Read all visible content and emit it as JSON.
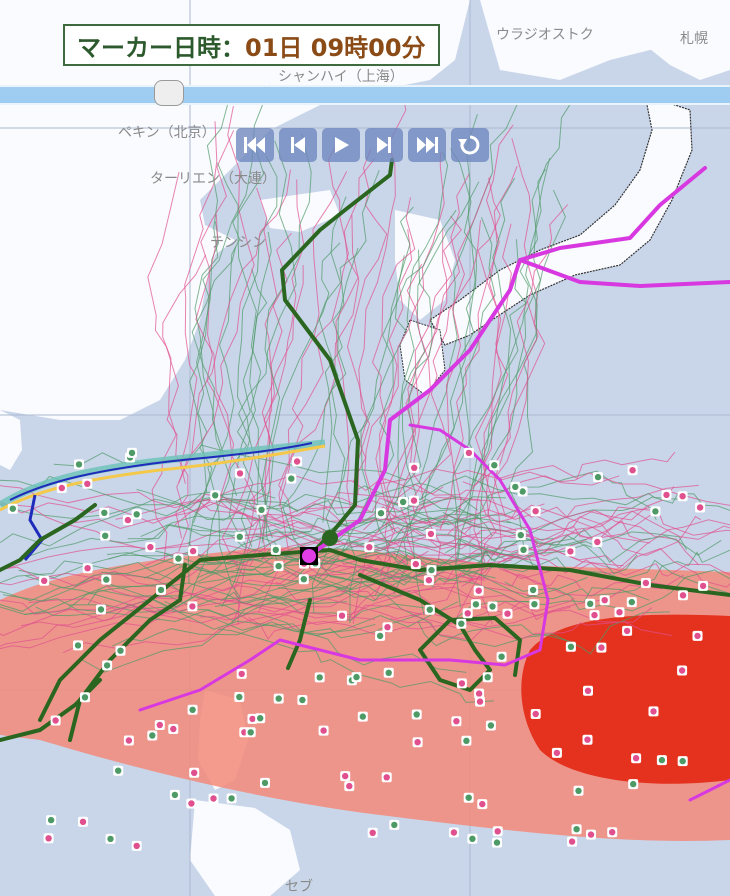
{
  "marker_time": {
    "label": "マーカー日時：",
    "value": "01日 09時00分"
  },
  "slider": {
    "level": 0.22
  },
  "controls": [
    {
      "name": "skip-to-start-button",
      "icon": "skip-start-icon"
    },
    {
      "name": "step-back-button",
      "icon": "step-back-icon"
    },
    {
      "name": "play-button",
      "icon": "play-icon"
    },
    {
      "name": "step-forward-button",
      "icon": "step-forward-icon"
    },
    {
      "name": "skip-to-end-button",
      "icon": "skip-end-icon"
    },
    {
      "name": "loop-button",
      "icon": "loop-icon"
    }
  ],
  "places": {
    "beijing": "ペキン（北京）",
    "dalian": "ターリエン（大連）",
    "tianjin": "テンシン",
    "shanghai": "シャンハイ（上海）",
    "vladivostok": "ウラジオストク",
    "sapporo": "札幌",
    "cebu": "セブ"
  },
  "colors": {
    "land": "#ffffff",
    "sea": "#c9d6ea",
    "forecast_circle": "#f38a7a",
    "forecast_core": "#e5321f",
    "track_main": "#2b6620",
    "track_magenta": "#d738e0",
    "ensemble_pink": "#e0508f",
    "ensemble_green": "#4e9a66"
  }
}
